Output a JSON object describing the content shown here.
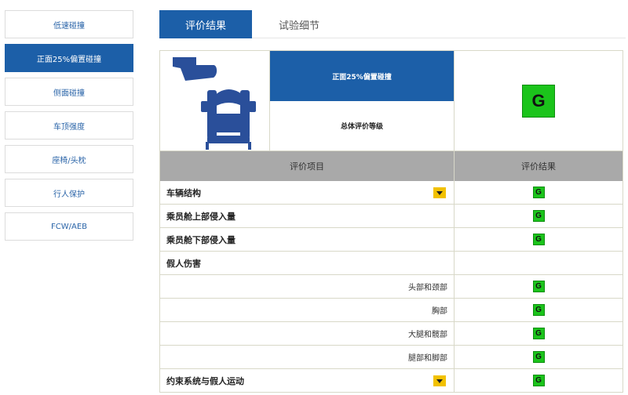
{
  "sidebar": {
    "items": [
      {
        "label": "低速碰撞",
        "active": false
      },
      {
        "label": "正面25%偏置碰撞",
        "active": true
      },
      {
        "label": "侧面碰撞",
        "active": false
      },
      {
        "label": "车顶强度",
        "active": false
      },
      {
        "label": "座椅/头枕",
        "active": false
      },
      {
        "label": "行人保护",
        "active": false
      },
      {
        "label": "FCW/AEB",
        "active": false
      }
    ]
  },
  "tabs": [
    {
      "label": "评价结果",
      "active": true
    },
    {
      "label": "试验细节",
      "active": false
    }
  ],
  "summary": {
    "test_name": "正面25%偏置碰撞",
    "overall_label": "总体评价等级",
    "overall_rating": "G"
  },
  "table": {
    "header_item": "评价项目",
    "header_result": "评价结果",
    "rows": [
      {
        "label": "车辆结构",
        "rating": "G",
        "expandable": true
      },
      {
        "label": "乘员舱上部侵入量",
        "rating": "G"
      },
      {
        "label": "乘员舱下部侵入量",
        "rating": "G"
      },
      {
        "label": "假人伤害",
        "rating": ""
      },
      {
        "label": "头部和颈部",
        "rating": "G"
      },
      {
        "label": "胸部",
        "rating": "G"
      },
      {
        "label": "大腿和髋部",
        "rating": "G"
      },
      {
        "label": "腿部和脚部",
        "rating": "G"
      },
      {
        "label": "约束系统与假人运动",
        "rating": "G",
        "expandable": true
      }
    ]
  },
  "colors": {
    "accent": "#1c5fa8",
    "good": "#1bc41b",
    "dropdown": "#f2c100"
  }
}
